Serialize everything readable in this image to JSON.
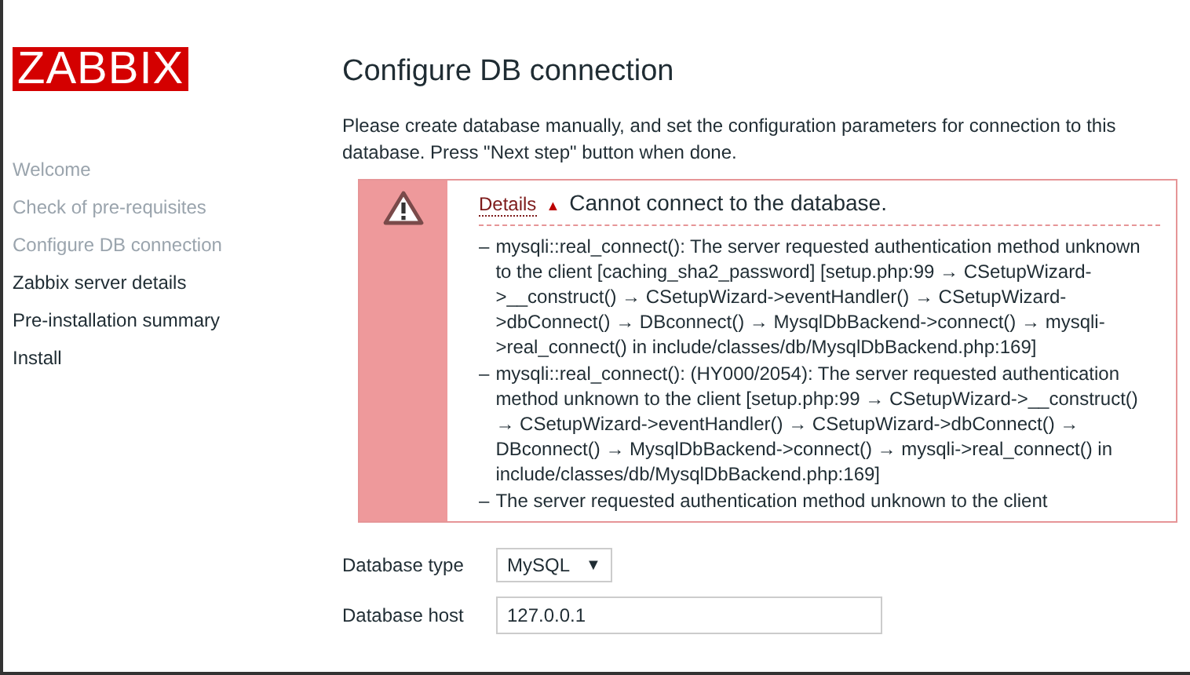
{
  "logo": "ZABBIX",
  "steps": [
    {
      "label": "Welcome",
      "done": true
    },
    {
      "label": "Check of pre-requisites",
      "done": true
    },
    {
      "label": "Configure DB connection",
      "done": true
    },
    {
      "label": "Zabbix server details",
      "done": false
    },
    {
      "label": "Pre-installation summary",
      "done": false
    },
    {
      "label": "Install",
      "done": false
    }
  ],
  "title": "Configure DB connection",
  "intro": "Please create database manually, and set the configuration parameters for connection to this database. Press \"Next step\" button when done.",
  "error": {
    "details_link": "Details",
    "toggle": "▲",
    "expanded": true,
    "message": "Cannot connect to the database.",
    "bullet": "–",
    "items": [
      "mysqli::real_connect(): The server requested authentication method unknown to the client [caching_sha2_password] [setup.php:99 → CSetupWizard->__construct() → CSetupWizard->eventHandler() → CSetupWizard->dbConnect() → DBconnect() → MysqlDbBackend->connect() → mysqli->real_connect() in include/classes/db/MysqlDbBackend.php:169]",
      "mysqli::real_connect(): (HY000/2054): The server requested authentication method unknown to the client [setup.php:99 → CSetupWizard->__construct() → CSetupWizard->eventHandler() → CSetupWizard->dbConnect() → DBconnect() → MysqlDbBackend->connect() → mysqli->real_connect() in include/classes/db/MysqlDbBackend.php:169]",
      "The server requested authentication method unknown to the client"
    ]
  },
  "form": [
    {
      "kind": "select",
      "label": "Database type",
      "value": "MySQL",
      "caret": "▼"
    },
    {
      "kind": "input",
      "label": "Database host",
      "value": "127.0.0.1"
    }
  ]
}
